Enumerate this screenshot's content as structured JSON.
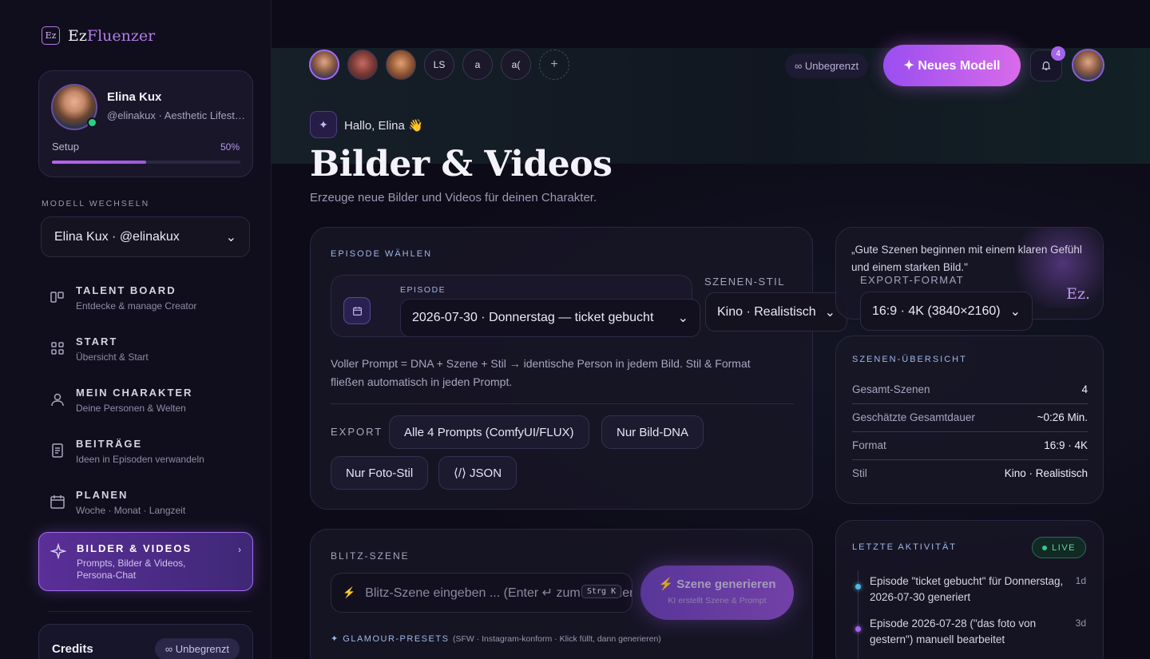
{
  "app": {
    "logo_badge": "Ez",
    "logo_main": "Ez",
    "logo_accent": "Fluenzer"
  },
  "profile": {
    "name": "Elina Kux",
    "handle": "@elinakux · Aesthetic Lifestyle",
    "setup_label": "Setup",
    "setup_percent": "50%",
    "setup_progress": 0.5
  },
  "model_switch": {
    "label": "MODELL WECHSELN",
    "selected": "Elina Kux · @elinakux"
  },
  "nav": [
    {
      "title": "TALENT BOARD",
      "sub": "Entdecke & manage Creator",
      "icon": "board-icon"
    },
    {
      "title": "START",
      "sub": "Übersicht & Start",
      "icon": "grid-icon"
    },
    {
      "title": "MEIN CHARAKTER",
      "sub": "Deine Personen & Welten",
      "icon": "user-icon"
    },
    {
      "title": "BEITRÄGE",
      "sub": "Ideen in Episoden verwandeln",
      "icon": "document-icon"
    },
    {
      "title": "PLANEN",
      "sub": "Woche · Monat · Langzeit",
      "icon": "calendar-icon"
    },
    {
      "title": "BILDER & VIDEOS",
      "sub": "Prompts, Bilder & Videos, Persona-Chat",
      "icon": "sparkle-icon",
      "active": true
    }
  ],
  "credits": {
    "label": "Credits",
    "badge": "∞ Unbegrenzt"
  },
  "topbar": {
    "avatars": [
      "",
      "",
      "",
      "LS",
      "a",
      "a("
    ],
    "add": "+",
    "unlimited": "∞ Unbegrenzt",
    "new_model": "✦ Neues Modell",
    "notifications": "4"
  },
  "header": {
    "greeting": "Hallo, Elina 👋",
    "title": "Bilder & Videos",
    "subtitle": "Erzeuge neue Bilder und Videos für deinen Charakter."
  },
  "episode_card": {
    "label": "EPISODE WÄHLEN",
    "episode_label": "EPISODE",
    "episode_value": "2026-07-30 · Donnerstag — ticket gebucht",
    "style_label": "SZENEN-STIL",
    "style_value": "Kino · Realistisch",
    "format_label": "EXPORT-FORMAT",
    "format_value": "16:9 · 4K (3840×2160)",
    "description": "Voller Prompt = DNA + Szene + Stil → identische Person in jedem Bild. Stil & Format fließen automatisch in jeden Prompt.",
    "export_label": "EXPORT",
    "export_buttons": [
      "Alle 4 Prompts (ComfyUI/FLUX)",
      "Nur Bild-DNA",
      "Nur Foto-Stil",
      "⟨/⟩ JSON"
    ]
  },
  "quote": {
    "text": "„Gute Szenen beginnen mit einem klaren Gefühl und einem starken Bild.\"",
    "mark": "Ez."
  },
  "overview": {
    "label": "SZENEN-ÜBERSICHT",
    "rows": [
      {
        "k": "Gesamt-Szenen",
        "v": "4"
      },
      {
        "k": "Geschätzte Gesamtdauer",
        "v": "~0:26 Min."
      },
      {
        "k": "Format",
        "v": "16:9 · 4K"
      },
      {
        "k": "Stil",
        "v": "Kino · Realistisch"
      }
    ]
  },
  "blitz": {
    "label": "BLITZ-SZENE",
    "placeholder": "Blitz-Szene eingeben ... (Enter ↵ zum Generieren)",
    "kbd": "Strg K",
    "gen_title": "⚡ Szene generieren",
    "gen_sub": "KI erstellt Szene & Prompt",
    "presets_label": "✦ GLAMOUR-PRESETS",
    "presets_note": "(SFW · Instagram-konform · Klick füllt, dann generieren)"
  },
  "activity": {
    "label": "LETZTE AKTIVITÄT",
    "live": "LIVE",
    "items": [
      {
        "text": "Episode \"ticket gebucht\" für Donnerstag, 2026-07-30 generiert",
        "time": "1d",
        "color": "#4fb8e8"
      },
      {
        "text": "Episode 2026-07-28 (\"das foto von gestern\") manuell bearbeitet",
        "time": "3d",
        "color": "#a463ea"
      }
    ]
  }
}
